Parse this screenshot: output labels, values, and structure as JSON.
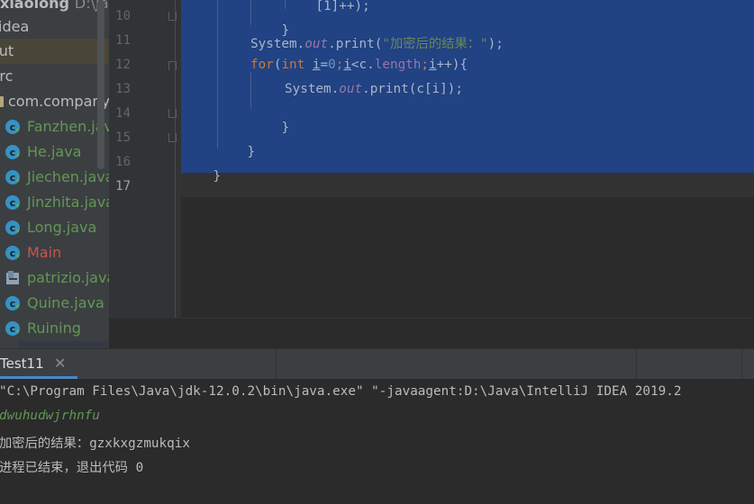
{
  "project_tree": {
    "root_name": "xiaolong",
    "root_path": "D:\\Java",
    "folders": [
      "idea",
      "out",
      "src"
    ],
    "package": "com.company",
    "files": [
      {
        "name": "Fanzhen.java",
        "kind": "java"
      },
      {
        "name": "He.java",
        "kind": "java"
      },
      {
        "name": "Jiechen.java",
        "kind": "java"
      },
      {
        "name": "Jinzhita.java",
        "kind": "java"
      },
      {
        "name": "Long.java",
        "kind": "java"
      },
      {
        "name": "Main",
        "kind": "main"
      },
      {
        "name": "patrizio.java",
        "kind": "interface"
      },
      {
        "name": "Quine.java",
        "kind": "java"
      },
      {
        "name": "Ruining",
        "kind": "java"
      }
    ]
  },
  "editor": {
    "line_numbers": [
      "10",
      "11",
      "12",
      "13",
      "14",
      "15",
      "16",
      "17"
    ],
    "current_line": "17",
    "code": {
      "line9_tail": "[1]++);",
      "line10": "}",
      "line11_a": "System.",
      "line11_b": "out",
      "line11_c": ".print(",
      "line11_str": "\"加密后的结果：\"",
      "line11_d": ");",
      "line12_for": "for",
      "line12_open": "(",
      "line12_int": "int ",
      "line12_i": "i",
      "line12_eq": "=",
      "line12_zero": "0",
      "line12_semi": ";",
      "line12_i2": "i",
      "line12_lt": "<c.",
      "line12_len": "length",
      "line12_semi2": ";",
      "line12_i3": "i",
      "line12_end": "++){",
      "line13_a": "System.",
      "line13_b": "out",
      "line13_c": ".print(c[i]);",
      "line14": "}",
      "line15": "}",
      "line16": "}"
    }
  },
  "run_window": {
    "tab_label": "Test11",
    "close_glyph": "✕",
    "console_lines": [
      {
        "text": "\"C:\\Program Files\\Java\\jdk-12.0.2\\bin\\java.exe\" \"-javaagent:D:\\Java\\IntelliJ IDEA 2019.2",
        "kind": "cmd"
      },
      {
        "text": "dwuhudwjrhnfu",
        "kind": "input"
      },
      {
        "text": "加密后的结果：gzxkxgzmukqix",
        "kind": "output"
      },
      {
        "text": "进程已结束，退出代码 0",
        "kind": "output"
      }
    ]
  },
  "colors": {
    "selection": "#214283",
    "keyword": "#cc7832",
    "string": "#6a8759",
    "field": "#9876aa",
    "number": "#6897bb",
    "accent": "#4a88c7"
  },
  "icons": {
    "java_class": "java-class-icon",
    "interface": "interface-icon",
    "package": "package-icon"
  }
}
